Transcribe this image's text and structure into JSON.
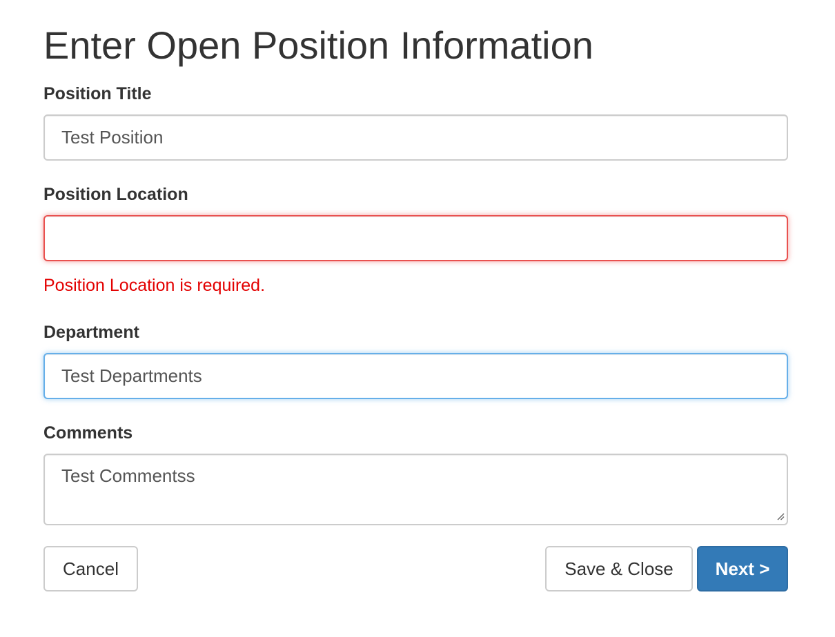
{
  "title": "Enter Open Position Information",
  "fields": {
    "position_title": {
      "label": "Position Title",
      "value": "Test Position"
    },
    "position_location": {
      "label": "Position Location",
      "value": "",
      "error": "Position Location is required."
    },
    "department": {
      "label": "Department",
      "value": "Test Departments"
    },
    "comments": {
      "label": "Comments",
      "value": "Test Commentss"
    }
  },
  "buttons": {
    "cancel": "Cancel",
    "save_close": "Save & Close",
    "next": "Next >"
  },
  "colors": {
    "primary": "#337ab7",
    "error": "#e30000",
    "focus": "#66afe9"
  }
}
